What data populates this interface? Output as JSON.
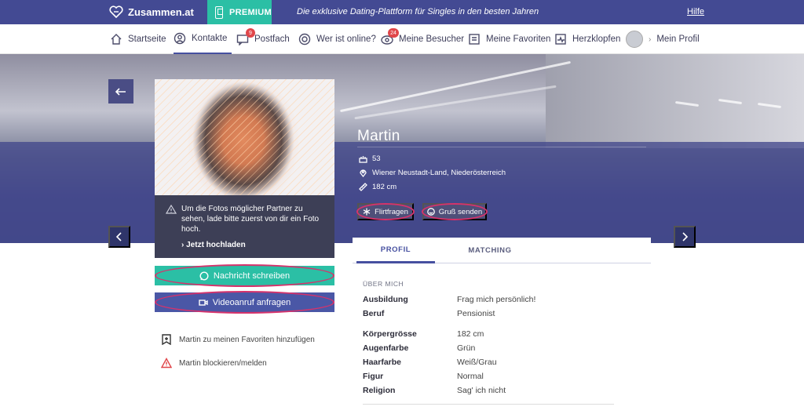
{
  "topbar": {
    "logo": "Zusammen.at",
    "premium": "PREMIUM",
    "tagline": "Die exklusive Dating-Plattform für Singles in den besten Jahren",
    "help": "Hilfe"
  },
  "nav": {
    "items": [
      {
        "label": "Startseite",
        "icon": "home-icon"
      },
      {
        "label": "Kontakte",
        "icon": "user-icon",
        "active": true
      },
      {
        "label": "Postfach",
        "icon": "mail-icon",
        "badge": "9"
      },
      {
        "label": "Wer ist online?",
        "icon": "online-icon"
      },
      {
        "label": "Meine Besucher",
        "icon": "visitors-icon",
        "badge": "24"
      },
      {
        "label": "Meine Favoriten",
        "icon": "favorites-icon"
      },
      {
        "label": "Herzklopfen",
        "icon": "heartbeat-icon"
      },
      {
        "label": "Mein Profil",
        "icon": "avatar"
      }
    ]
  },
  "photo": {
    "notice": "Um die Fotos möglicher Partner zu sehen, lade bitte zuerst von dir ein Foto hoch.",
    "upload_link": "Jetzt hochladen"
  },
  "actions": {
    "message": "Nachricht schreiben",
    "video": "Videoanruf anfragen",
    "favorite": "Martin zu meinen Favoriten hinzufügen",
    "block": "Martin blockieren/melden"
  },
  "profile": {
    "name": "Martin",
    "age": "53",
    "location": "Wiener Neustadt-Land, Niederösterreich",
    "height": "182 cm",
    "flirt_button": "Flirtfragen",
    "greet_button": "Gruß senden"
  },
  "tabs": [
    "PROFIL",
    "MATCHING"
  ],
  "details": {
    "section_title": "ÜBER MICH",
    "rows": [
      {
        "key": "Ausbildung",
        "value": "Frag mich persönlich!"
      },
      {
        "key": "Beruf",
        "value": "Pensionist"
      },
      {
        "key": "Körpergrösse",
        "value": "182 cm"
      },
      {
        "key": "Augenfarbe",
        "value": "Grün"
      },
      {
        "key": "Haarfarbe",
        "value": "Weiß/Grau"
      },
      {
        "key": "Figur",
        "value": "Normal"
      },
      {
        "key": "Religion",
        "value": "Sag' ich nicht"
      }
    ]
  },
  "colors": {
    "brand": "#434a93",
    "premium": "#2bbfa5",
    "highlight_ring": "#d6336c",
    "badge": "#e0464a"
  }
}
